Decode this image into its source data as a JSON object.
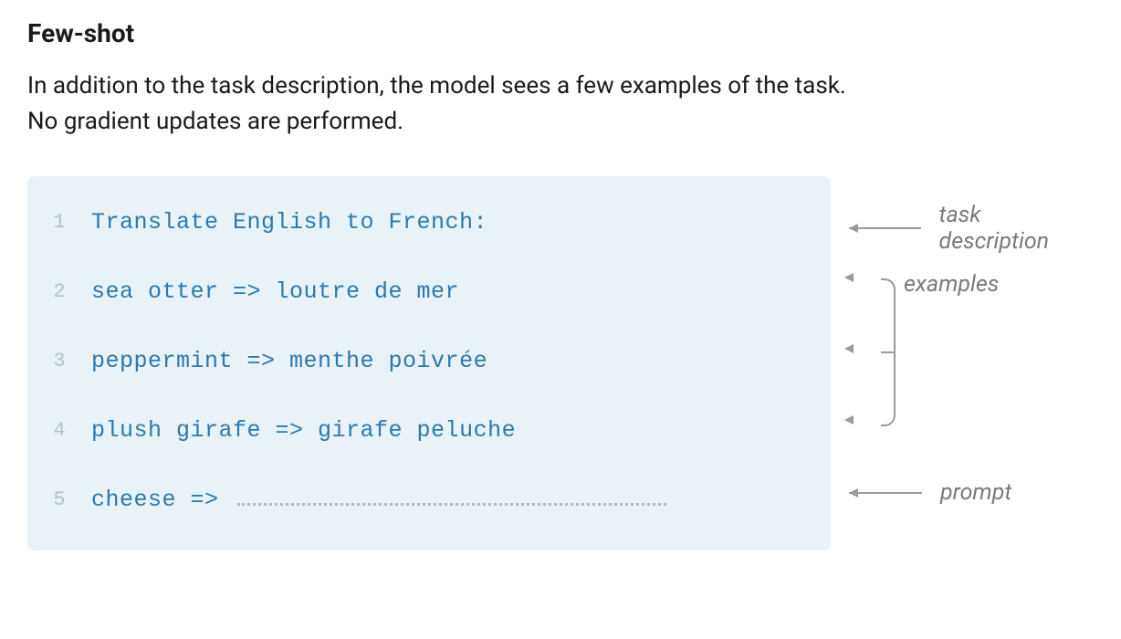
{
  "title": "Few-shot",
  "description": "In addition to the task description, the model sees a few examples of the task. No gradient updates are performed.",
  "code": {
    "lines": [
      {
        "num": "1",
        "text": "Translate English to French:"
      },
      {
        "num": "2",
        "text": "sea otter => loutre de mer"
      },
      {
        "num": "3",
        "text": "peppermint => menthe poivrée"
      },
      {
        "num": "4",
        "text": "plush girafe => girafe peluche"
      },
      {
        "num": "5",
        "text": "cheese =>"
      }
    ]
  },
  "annotations": {
    "task": "task description",
    "examples": "examples",
    "prompt": "prompt"
  }
}
